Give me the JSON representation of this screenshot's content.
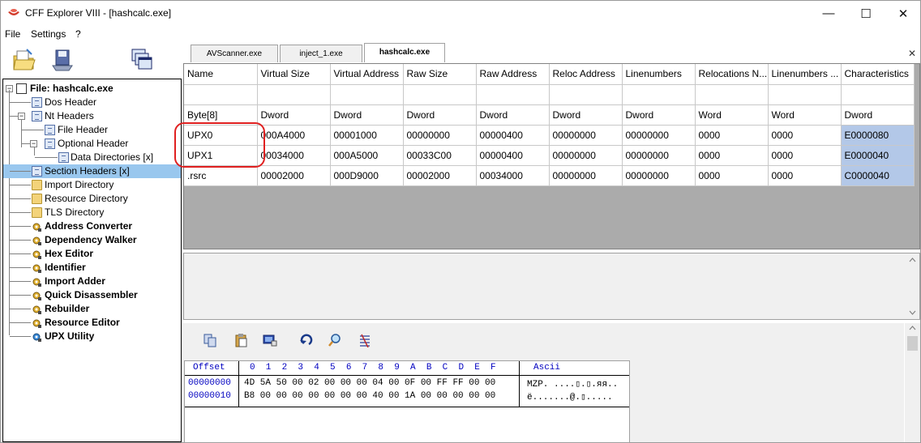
{
  "window": {
    "title": "CFF Explorer VIII - [hashcalc.exe]",
    "controls": {
      "minimize": "—",
      "maximize": "☐",
      "close": "✕"
    }
  },
  "menu": [
    "File",
    "Settings",
    "?"
  ],
  "toolbar_icons": [
    "open-file-icon",
    "save-file-icon",
    "windows-icon"
  ],
  "tree": {
    "root": "File: hashcalc.exe",
    "items": [
      {
        "label": "Dos Header",
        "icon": "doc-icon",
        "bold": false
      },
      {
        "label": "Nt Headers",
        "icon": "doc-icon",
        "bold": false
      },
      {
        "label": "File Header",
        "icon": "doc-icon",
        "bold": false
      },
      {
        "label": "Optional Header",
        "icon": "doc-icon",
        "bold": false
      },
      {
        "label": "Data Directories [x]",
        "icon": "doc-icon",
        "bold": false
      },
      {
        "label": "Section Headers [x]",
        "icon": "doc-icon",
        "bold": false,
        "selected": true
      },
      {
        "label": "Import Directory",
        "icon": "folder-icon",
        "bold": false
      },
      {
        "label": "Resource Directory",
        "icon": "folder-icon",
        "bold": false
      },
      {
        "label": "TLS Directory",
        "icon": "folder-icon",
        "bold": false
      },
      {
        "label": "Address Converter",
        "icon": "tool-icon",
        "bold": true
      },
      {
        "label": "Dependency Walker",
        "icon": "tool-icon",
        "bold": true
      },
      {
        "label": "Hex Editor",
        "icon": "tool-icon",
        "bold": true
      },
      {
        "label": "Identifier",
        "icon": "tool-icon",
        "bold": true
      },
      {
        "label": "Import Adder",
        "icon": "tool-icon",
        "bold": true
      },
      {
        "label": "Quick Disassembler",
        "icon": "tool-icon",
        "bold": true
      },
      {
        "label": "Rebuilder",
        "icon": "tool-icon",
        "bold": true
      },
      {
        "label": "Resource Editor",
        "icon": "tool-icon",
        "bold": true
      },
      {
        "label": "UPX Utility",
        "icon": "tool-icon",
        "bold": true
      }
    ]
  },
  "tabs": [
    {
      "label": "AVScanner.exe",
      "active": false
    },
    {
      "label": "inject_1.exe",
      "active": false
    },
    {
      "label": "hashcalc.exe",
      "active": true
    }
  ],
  "tab_close": "✕",
  "sections": {
    "columns": [
      "Name",
      "Virtual Size",
      "Virtual Address",
      "Raw Size",
      "Raw Address",
      "Reloc Address",
      "Linenumbers",
      "Relocations N...",
      "Linenumbers ...",
      "Characteristics"
    ],
    "types": [
      "Byte[8]",
      "Dword",
      "Dword",
      "Dword",
      "Dword",
      "Dword",
      "Dword",
      "Word",
      "Word",
      "Dword"
    ],
    "rows": [
      [
        "UPX0",
        "000A4000",
        "00001000",
        "00000000",
        "00000400",
        "00000000",
        "00000000",
        "0000",
        "0000",
        "E0000080"
      ],
      [
        "UPX1",
        "00034000",
        "000A5000",
        "00033C00",
        "00000400",
        "00000000",
        "00000000",
        "0000",
        "0000",
        "E0000040"
      ],
      [
        ".rsrc",
        "00002000",
        "000D9000",
        "00002000",
        "00034000",
        "00000000",
        "00000000",
        "0000",
        "0000",
        "C0000040"
      ]
    ]
  },
  "hex": {
    "offset_label": "Offset",
    "byte_cols": "0  1  2  3  4  5  6  7  8  9  A  B  C  D  E  F",
    "ascii_label": "Ascii",
    "rows": [
      {
        "offset": "00000000",
        "bytes": "4D 5A 50 00 02 00 00 00 04 00 0F 00 FF FF 00 00",
        "ascii": "MZP. ....▯.▯.яя.."
      },
      {
        "offset": "00000010",
        "bytes": "B8 00 00 00 00 00 00 00 40 00 1A 00 00 00 00 00",
        "ascii": "ё.......@.▯....."
      }
    ]
  },
  "hex_toolbar_icons": [
    "copy-icon",
    "paste-icon",
    "select-icon",
    "goto-icon",
    "search-icon",
    "replace-icon"
  ]
}
